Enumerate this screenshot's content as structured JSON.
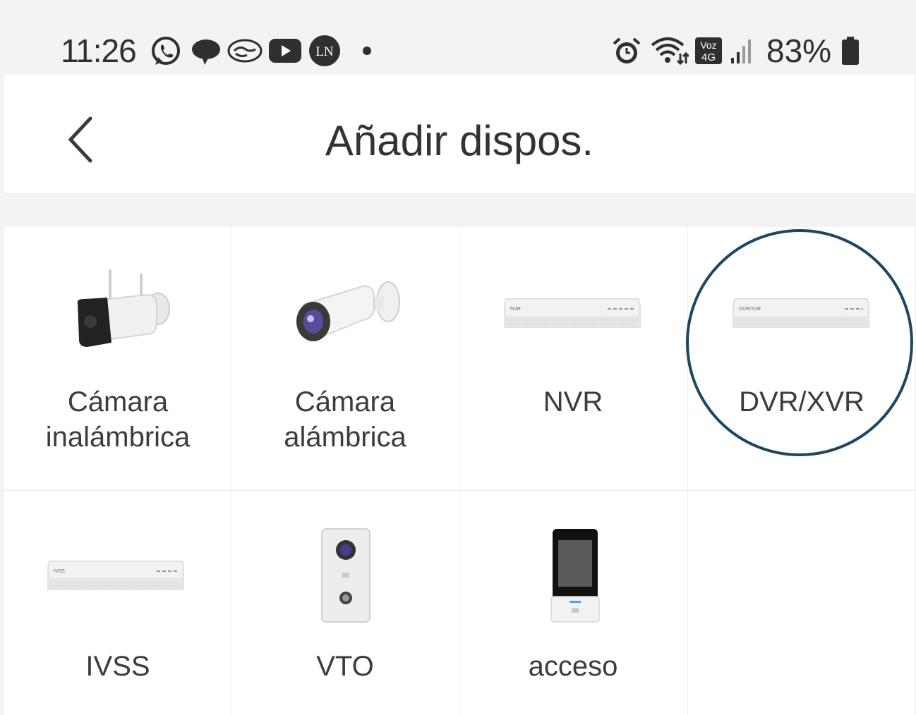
{
  "status_bar": {
    "time": "11:26",
    "battery_percent": "83%",
    "notification_icons": [
      "whatsapp-icon",
      "chat-bubble-icon",
      "handshake-icon",
      "youtube-icon",
      "ln-icon",
      "dot-icon"
    ],
    "notification_ln_text": "LN",
    "system_icons": [
      "alarm-icon",
      "wifi-icon",
      "volte-4g-icon",
      "signal-icon",
      "battery-icon"
    ],
    "volte_top": "Voz",
    "volte_bottom": "4G"
  },
  "header": {
    "title": "Añadir dispos.",
    "back_icon": "chevron-left-icon"
  },
  "devices": [
    {
      "label_line1": "Cámara",
      "label_line2": "inalámbrica",
      "icon": "wireless-camera-icon"
    },
    {
      "label_line1": "Cámara",
      "label_line2": "alámbrica",
      "icon": "wired-camera-icon"
    },
    {
      "label_line1": "NVR",
      "label_line2": "",
      "icon": "nvr-recorder-icon",
      "device_tag": "NVR"
    },
    {
      "label_line1": "DVR/XVR",
      "label_line2": "",
      "icon": "dvr-recorder-icon",
      "device_tag": "DVR/XVR",
      "highlighted": true
    },
    {
      "label_line1": "IVSS",
      "label_line2": "",
      "icon": "ivss-recorder-icon",
      "device_tag": "IVSS"
    },
    {
      "label_line1": "VTO",
      "label_line2": "",
      "icon": "doorbell-station-icon"
    },
    {
      "label_line1": "acceso",
      "label_line2": "",
      "icon": "access-control-terminal-icon"
    }
  ],
  "colors": {
    "highlight_circle": "#1e4660",
    "background": "#f3f3f3",
    "card": "#ffffff",
    "text": "#3c3c3c"
  }
}
